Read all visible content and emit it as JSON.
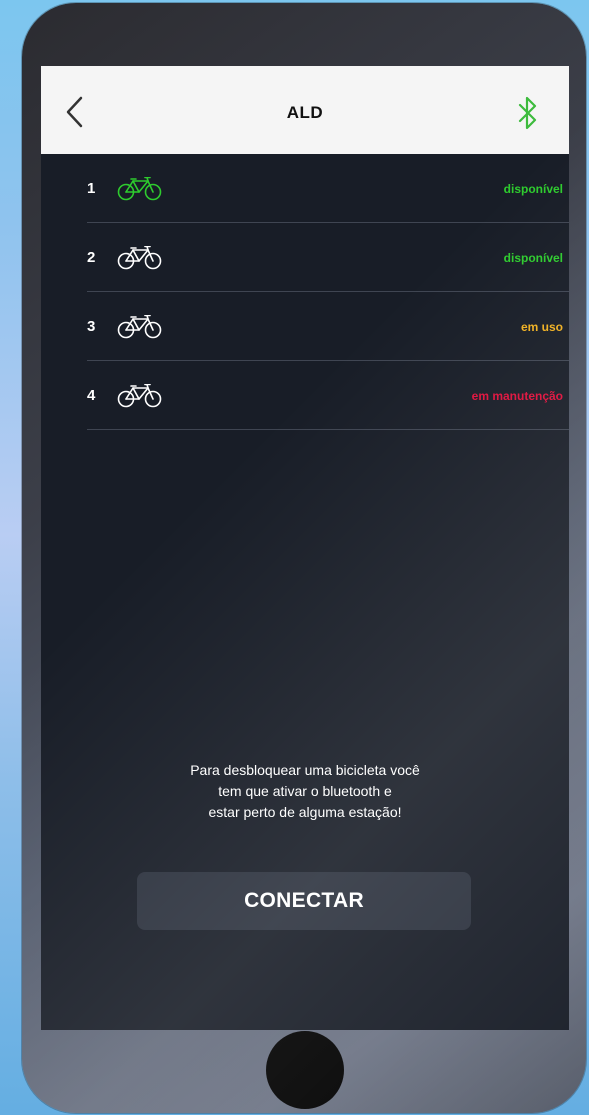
{
  "header": {
    "title": "ALD",
    "back_icon": "chevron-left-icon",
    "bluetooth_icon": "bluetooth-icon",
    "bluetooth_color": "#3dbb3d"
  },
  "bikes": [
    {
      "number": "1",
      "status": "disponível",
      "status_color": "#2ecc2e",
      "icon_color": "#2ecc2e"
    },
    {
      "number": "2",
      "status": "disponível",
      "status_color": "#2ecc2e",
      "icon_color": "#ffffff"
    },
    {
      "number": "3",
      "status": "em uso",
      "status_color": "#f0b020",
      "icon_color": "#ffffff"
    },
    {
      "number": "4",
      "status": "em manutenção",
      "status_color": "#e0103c",
      "icon_color": "#ffffff"
    }
  ],
  "info": {
    "line1": "Para desbloquear uma bicicleta você",
    "line2": "tem que ativar o bluetooth e",
    "line3": "estar perto de alguma estação!"
  },
  "connect_button": {
    "label": "CONECTAR"
  }
}
